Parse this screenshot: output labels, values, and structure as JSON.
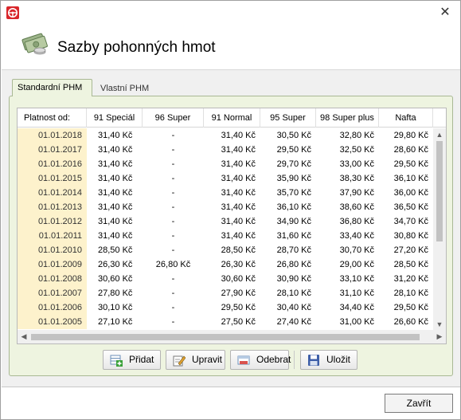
{
  "window": {
    "title": "Sazby pohonných hmot",
    "close_glyph": "✕",
    "app_icon": "steering-wheel-icon",
    "header_icon": "money-icon"
  },
  "tabs": [
    {
      "label": "Standardní PHM",
      "active": true
    },
    {
      "label": "Vlastní PHM",
      "active": false
    }
  ],
  "table": {
    "columns": [
      "Platnost od:",
      "91 Speciál",
      "96 Super",
      "91 Normal",
      "95 Super",
      "98 Super plus",
      "Nafta"
    ],
    "rows": [
      [
        "01.01.2018",
        "31,40 Kč",
        "-",
        "31,40 Kč",
        "30,50 Kč",
        "32,80 Kč",
        "29,80 Kč"
      ],
      [
        "01.01.2017",
        "31,40 Kč",
        "-",
        "31,40 Kč",
        "29,50 Kč",
        "32,50 Kč",
        "28,60 Kč"
      ],
      [
        "01.01.2016",
        "31,40 Kč",
        "-",
        "31,40 Kč",
        "29,70 Kč",
        "33,00 Kč",
        "29,50 Kč"
      ],
      [
        "01.01.2015",
        "31,40 Kč",
        "-",
        "31,40 Kč",
        "35,90 Kč",
        "38,30 Kč",
        "36,10 Kč"
      ],
      [
        "01.01.2014",
        "31,40 Kč",
        "-",
        "31,40 Kč",
        "35,70 Kč",
        "37,90 Kč",
        "36,00 Kč"
      ],
      [
        "01.01.2013",
        "31,40 Kč",
        "-",
        "31,40 Kč",
        "36,10 Kč",
        "38,60 Kč",
        "36,50 Kč"
      ],
      [
        "01.01.2012",
        "31,40 Kč",
        "-",
        "31,40 Kč",
        "34,90 Kč",
        "36,80 Kč",
        "34,70 Kč"
      ],
      [
        "01.01.2011",
        "31,40 Kč",
        "-",
        "31,40 Kč",
        "31,60 Kč",
        "33,40 Kč",
        "30,80 Kč"
      ],
      [
        "01.01.2010",
        "28,50 Kč",
        "-",
        "28,50 Kč",
        "28,70 Kč",
        "30,70 Kč",
        "27,20 Kč"
      ],
      [
        "01.01.2009",
        "26,30 Kč",
        "26,80 Kč",
        "26,30 Kč",
        "26,80 Kč",
        "29,00 Kč",
        "28,50 Kč"
      ],
      [
        "01.01.2008",
        "30,60 Kč",
        "-",
        "30,60 Kč",
        "30,90 Kč",
        "33,10 Kč",
        "31,20 Kč"
      ],
      [
        "01.01.2007",
        "27,80 Kč",
        "-",
        "27,90 Kč",
        "28,10 Kč",
        "31,10 Kč",
        "28,10 Kč"
      ],
      [
        "01.01.2006",
        "30,10 Kč",
        "-",
        "29,50 Kč",
        "30,40 Kč",
        "34,40 Kč",
        "29,50 Kč"
      ],
      [
        "01.01.2005",
        "27,10 Kč",
        "-",
        "27,50 Kč",
        "27,40 Kč",
        "31,00 Kč",
        "26,60 Kč"
      ]
    ]
  },
  "toolbar": {
    "add_label": "Přidat",
    "edit_label": "Upravit",
    "remove_label": "Odebrat",
    "save_label": "Uložit"
  },
  "footer": {
    "close_label": "Zavřít"
  },
  "colors": {
    "tab_panel_bg": "#eef4e0",
    "date_column_bg": "#fdf2cc",
    "title_icon_red": "#d9262b"
  }
}
